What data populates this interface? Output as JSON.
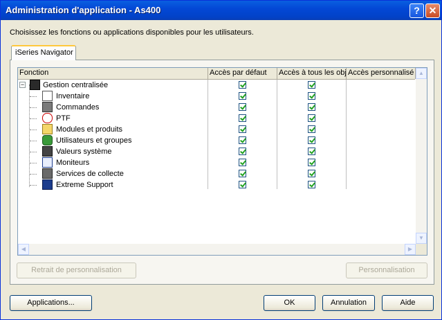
{
  "window": {
    "title": "Administration d'application - As400",
    "help_button": "?",
    "close_button": "✕"
  },
  "description": "Choisissez les fonctions ou applications disponibles pour les utilisateurs.",
  "tabs": [
    {
      "label": "iSeries Navigator"
    }
  ],
  "table": {
    "columns": [
      "Fonction",
      "Accès par défaut",
      "Accès à tous les obj",
      "Accès personnalisé"
    ],
    "root": {
      "label": "Gestion centralisée",
      "expander": "−",
      "default_access": true,
      "all_objects_access": true
    },
    "children": [
      {
        "label": "Inventaire",
        "icon": "inventory-icon",
        "default_access": true,
        "all_objects_access": true
      },
      {
        "label": "Commandes",
        "icon": "commands-icon",
        "default_access": true,
        "all_objects_access": true
      },
      {
        "label": "PTF",
        "icon": "ptf-icon",
        "default_access": true,
        "all_objects_access": true
      },
      {
        "label": "Modules et produits",
        "icon": "folder-icon",
        "default_access": true,
        "all_objects_access": true
      },
      {
        "label": "Utilisateurs et groupes",
        "icon": "users-icon",
        "default_access": true,
        "all_objects_access": true
      },
      {
        "label": "Valeurs système",
        "icon": "system-values-icon",
        "default_access": true,
        "all_objects_access": true
      },
      {
        "label": "Moniteurs",
        "icon": "monitor-icon",
        "default_access": true,
        "all_objects_access": true
      },
      {
        "label": "Services de collecte",
        "icon": "collection-services-icon",
        "default_access": true,
        "all_objects_access": true
      },
      {
        "label": "Extreme Support",
        "icon": "extreme-support-icon",
        "default_access": true,
        "all_objects_access": true
      }
    ]
  },
  "scroll_arrows": {
    "left": "◀",
    "right": "▶",
    "up": "▲",
    "down": "▼"
  },
  "buttons": {
    "remove_customization": "Retrait de personnalisation",
    "customize": "Personnalisation",
    "applications": "Applications...",
    "ok": "OK",
    "cancel": "Annulation",
    "help": "Aide"
  },
  "colors": {
    "title_bar": "#0348d6",
    "dialog_bg": "#ece9d8",
    "check_mark": "#21a121"
  }
}
